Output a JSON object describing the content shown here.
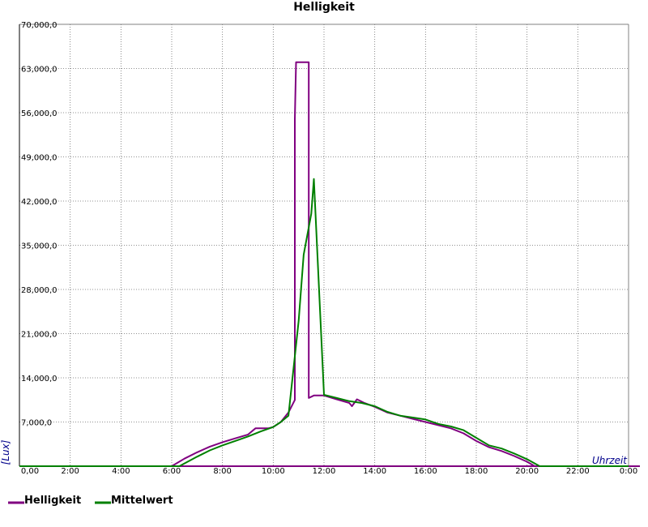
{
  "chart_data": {
    "type": "line",
    "title": "Helligkeit",
    "xlabel": "Uhrzeit",
    "ylabel": "[Lux]",
    "x_unit": "hour of day",
    "xlim": [
      0,
      24
    ],
    "ylim": [
      0,
      70000
    ],
    "xticks": [
      0,
      2,
      4,
      6,
      8,
      10,
      12,
      14,
      16,
      18,
      20,
      22,
      24
    ],
    "xtick_labels": [
      "0,00",
      "2:00",
      "4:00",
      "6:00",
      "8:00",
      "10:00",
      "12:00",
      "14:00",
      "16:00",
      "18:00",
      "20:00",
      "22:00",
      "0:00"
    ],
    "yticks": [
      0,
      7000,
      14000,
      21000,
      28000,
      35000,
      42000,
      49000,
      56000,
      63000,
      70000
    ],
    "ytick_labels": [
      "0,00",
      "7,000,0",
      "14,000,0",
      "21,000,0",
      "28,000,0",
      "35,000,0",
      "42,000,0",
      "49,000,0",
      "56,000,0",
      "63,000,0",
      "70,000,0"
    ],
    "grid": true,
    "legend_position": "bottom-left",
    "series": [
      {
        "name": "Helligkeit",
        "color": "#800080",
        "step": true,
        "points": [
          [
            0,
            0
          ],
          [
            6,
            0
          ],
          [
            6.5,
            1200
          ],
          [
            7,
            2200
          ],
          [
            7.5,
            3100
          ],
          [
            8,
            3800
          ],
          [
            8.5,
            4400
          ],
          [
            9,
            5000
          ],
          [
            9.3,
            6000
          ],
          [
            9.8,
            6000
          ],
          [
            10,
            6200
          ],
          [
            10.3,
            7000
          ],
          [
            10.6,
            8500
          ],
          [
            10.85,
            10500
          ],
          [
            10.85,
            55000
          ],
          [
            10.9,
            64000
          ],
          [
            11.4,
            64000
          ],
          [
            11.4,
            10800
          ],
          [
            11.6,
            11200
          ],
          [
            12,
            11200
          ],
          [
            12.5,
            10600
          ],
          [
            13,
            10000
          ],
          [
            13.1,
            9500
          ],
          [
            13.3,
            10600
          ],
          [
            13.6,
            10000
          ],
          [
            14,
            9400
          ],
          [
            14.5,
            8500
          ],
          [
            15,
            8000
          ],
          [
            15.5,
            7500
          ],
          [
            16,
            7000
          ],
          [
            16.5,
            6500
          ],
          [
            17,
            6000
          ],
          [
            17.5,
            5200
          ],
          [
            18,
            4000
          ],
          [
            18.5,
            3000
          ],
          [
            19,
            2400
          ],
          [
            19.5,
            1600
          ],
          [
            20,
            700
          ],
          [
            20.3,
            0
          ],
          [
            24,
            0
          ]
        ]
      },
      {
        "name": "Mittelwert",
        "color": "#008000",
        "step": false,
        "points": [
          [
            0,
            0
          ],
          [
            6.3,
            0
          ],
          [
            7,
            1500
          ],
          [
            7.5,
            2500
          ],
          [
            8,
            3300
          ],
          [
            8.5,
            4000
          ],
          [
            9,
            4700
          ],
          [
            9.5,
            5500
          ],
          [
            10,
            6200
          ],
          [
            10.3,
            7000
          ],
          [
            10.6,
            8000
          ],
          [
            11,
            23000
          ],
          [
            11.2,
            33500
          ],
          [
            11.5,
            40000
          ],
          [
            11.6,
            45500
          ],
          [
            12,
            11300
          ],
          [
            12.5,
            10800
          ],
          [
            13,
            10300
          ],
          [
            13.5,
            10000
          ],
          [
            14,
            9500
          ],
          [
            14.5,
            8600
          ],
          [
            15,
            8000
          ],
          [
            15.5,
            7700
          ],
          [
            16,
            7400
          ],
          [
            16.5,
            6700
          ],
          [
            17,
            6300
          ],
          [
            17.5,
            5700
          ],
          [
            18,
            4500
          ],
          [
            18.5,
            3300
          ],
          [
            19,
            2800
          ],
          [
            19.5,
            2000
          ],
          [
            20,
            1100
          ],
          [
            20.5,
            0
          ],
          [
            24,
            0
          ]
        ]
      }
    ]
  }
}
